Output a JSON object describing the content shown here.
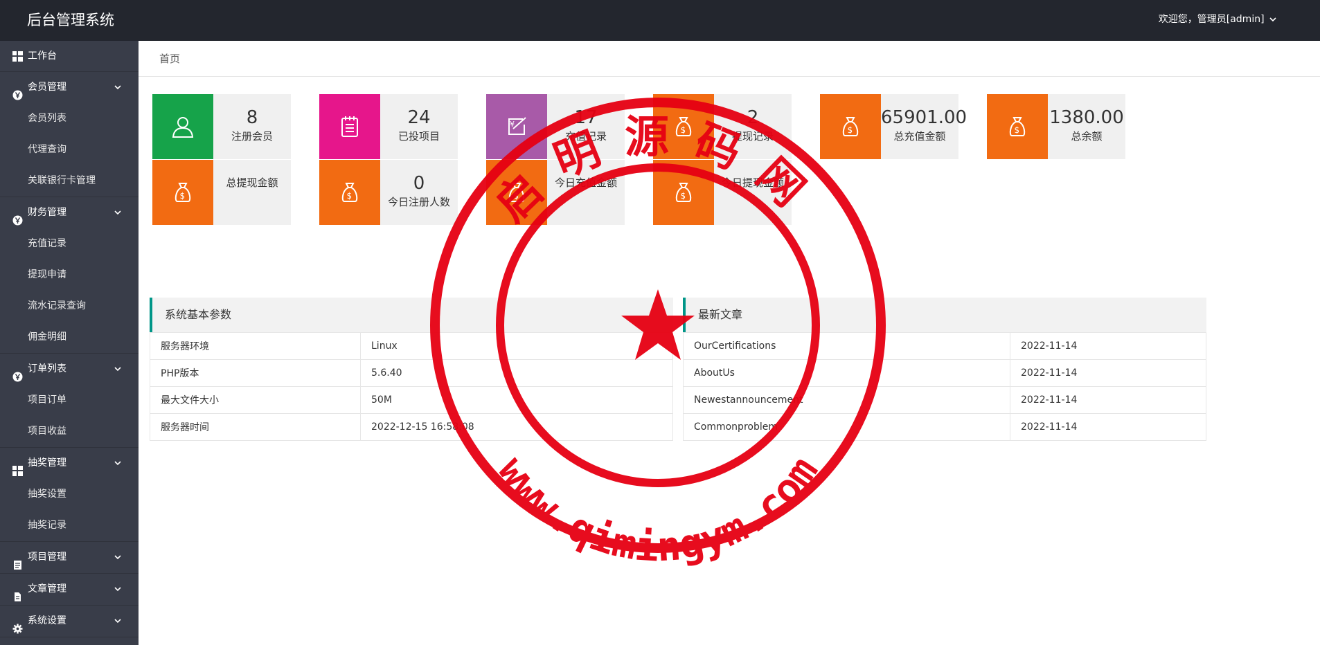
{
  "app": {
    "title": "后台管理系统",
    "user_greeting": "欢迎您，管理员[admin]"
  },
  "sidebar": {
    "workbench": "工作台",
    "groups": [
      {
        "label": "会员管理",
        "icon": "circle-y-icon",
        "items": [
          "会员列表",
          "代理查询",
          "关联银行卡管理"
        ]
      },
      {
        "label": "财务管理",
        "icon": "circle-y-icon",
        "items": [
          "充值记录",
          "提现申请",
          "流水记录查询",
          "佣金明细"
        ]
      },
      {
        "label": "订单列表",
        "icon": "circle-y-icon",
        "items": [
          "项目订单",
          "项目收益"
        ]
      },
      {
        "label": "抽奖管理",
        "icon": "grid-icon",
        "items": [
          "抽奖设置",
          "抽奖记录"
        ]
      },
      {
        "label": "项目管理",
        "icon": "doc-icon",
        "items": []
      },
      {
        "label": "文章管理",
        "icon": "file-icon",
        "items": []
      },
      {
        "label": "系统设置",
        "icon": "gear-icon",
        "items": []
      }
    ]
  },
  "breadcrumb": "首页",
  "cards": [
    {
      "value": "8",
      "label": "注册会员",
      "color": "#16a34a",
      "icon": "user-icon"
    },
    {
      "value": "24",
      "label": "已投项目",
      "color": "#e6168b",
      "icon": "clipboard-icon"
    },
    {
      "value": "17",
      "label": "充值记录",
      "color": "#a85aa8",
      "icon": "yen-card-icon"
    },
    {
      "value": "2",
      "label": "提现记录",
      "color": "#f26b12",
      "icon": "money-bag-icon"
    },
    {
      "value": "65901.00",
      "label": "总充值金额",
      "color": "#f26b12",
      "icon": "money-bag-icon"
    },
    {
      "value": "1380.00",
      "label": "总余额",
      "color": "#f26b12",
      "icon": "money-bag-icon"
    },
    {
      "value": "",
      "label": "总提现金额",
      "color": "#f26b12",
      "icon": "money-bag-icon"
    },
    {
      "value": "0",
      "label": "今日注册人数",
      "color": "#f26b12",
      "icon": "money-bag-icon"
    },
    {
      "value": "",
      "label": "今日充值金额",
      "color": "#f26b12",
      "icon": "money-bag-icon"
    },
    {
      "value": "",
      "label": "今日提现金额",
      "color": "#f26b12",
      "icon": "money-bag-icon"
    }
  ],
  "system_panel": {
    "title": "系统基本参数",
    "rows": [
      [
        "服务器环境",
        "Linux"
      ],
      [
        "PHP版本",
        "5.6.40"
      ],
      [
        "最大文件大小",
        "50M"
      ],
      [
        "服务器时间",
        "2022-12-15 16:58:08"
      ]
    ]
  },
  "articles_panel": {
    "title": "最新文章",
    "rows": [
      [
        "OurCertifications",
        "2022-11-14"
      ],
      [
        "AboutUs",
        "2022-11-14"
      ],
      [
        "Newestannouncement",
        "2022-11-14"
      ],
      [
        "Commonproblem",
        "2022-11-14"
      ]
    ]
  },
  "watermark": {
    "top_text": "启明源码网",
    "bottom_text": "www.qimingym.com",
    "color": "#e60012"
  }
}
